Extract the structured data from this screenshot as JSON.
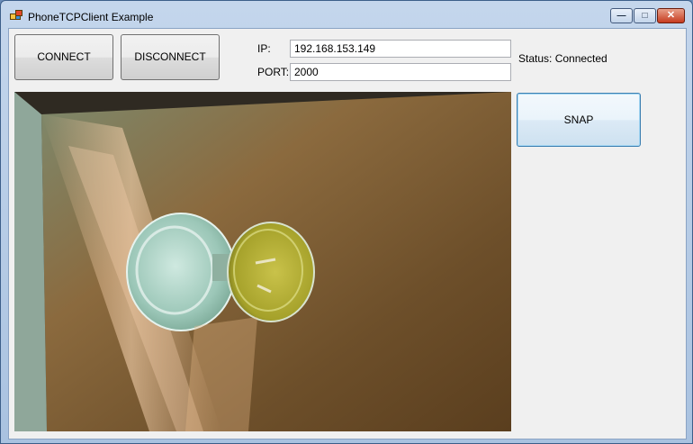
{
  "window": {
    "title": "PhoneTCPClient Example"
  },
  "buttons": {
    "connect": "CONNECT",
    "disconnect": "DISCONNECT",
    "snap": "SNAP"
  },
  "connection": {
    "ip_label": "IP:",
    "ip_value": "192.168.153.149",
    "port_label": "PORT:",
    "port_value": "2000"
  },
  "status": {
    "text": "Status: Connected"
  },
  "caption_buttons": {
    "minimize": "minimize-icon",
    "maximize": "maximize-icon",
    "close": "close-icon"
  }
}
